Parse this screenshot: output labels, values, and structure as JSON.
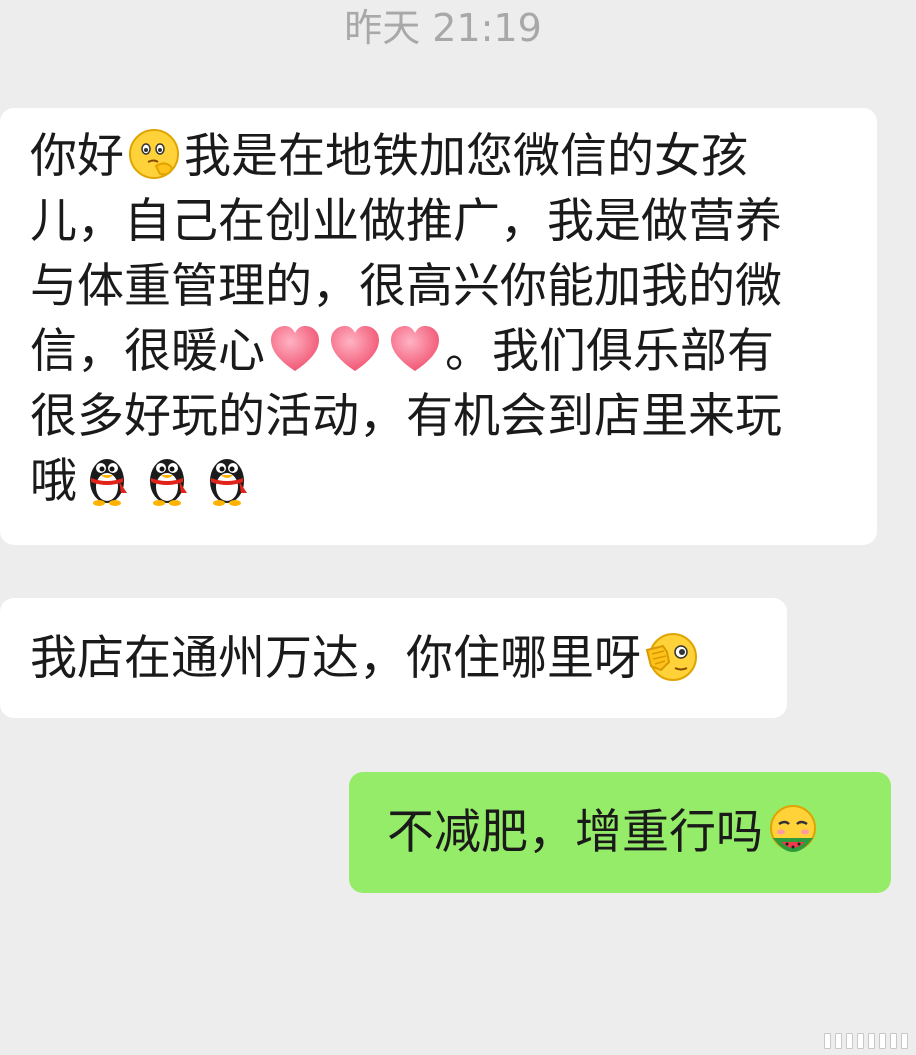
{
  "chat": {
    "timestamp": "昨天 21:19",
    "messages": [
      {
        "sender": "other",
        "lines": [
          [
            "你好",
            "emoji:thinking",
            "我是在地铁加您微信的女孩"
          ],
          [
            "儿，自己在创业做推广，我是做营养"
          ],
          [
            "与体重管理的，很高兴你能加我的微"
          ],
          [
            "信，很暖心",
            "emoji:heart",
            "emoji:heart",
            "emoji:heart",
            "。我们俱乐部有"
          ],
          [
            "很多好玩的活动，有机会到店里来玩"
          ],
          [
            "哦",
            "emoji:penguin",
            "emoji:penguin",
            "emoji:penguin"
          ]
        ]
      },
      {
        "sender": "other",
        "lines": [
          [
            "我店在通州万达，你住哪里呀",
            "emoji:peek"
          ]
        ]
      },
      {
        "sender": "self",
        "lines": [
          [
            "不减肥，增重行吗",
            "emoji:eating-watermelon"
          ]
        ]
      }
    ]
  },
  "emoji_icons": {
    "thinking": "thinking-face-icon",
    "heart": "heart-icon",
    "penguin": "penguin-icon",
    "peek": "peeking-face-icon",
    "eating-watermelon": "eating-watermelon-face-icon"
  },
  "colors": {
    "background": "#ededed",
    "incoming_bubble": "#ffffff",
    "outgoing_bubble": "#95ec69",
    "timestamp_text": "#a8a8a8"
  }
}
